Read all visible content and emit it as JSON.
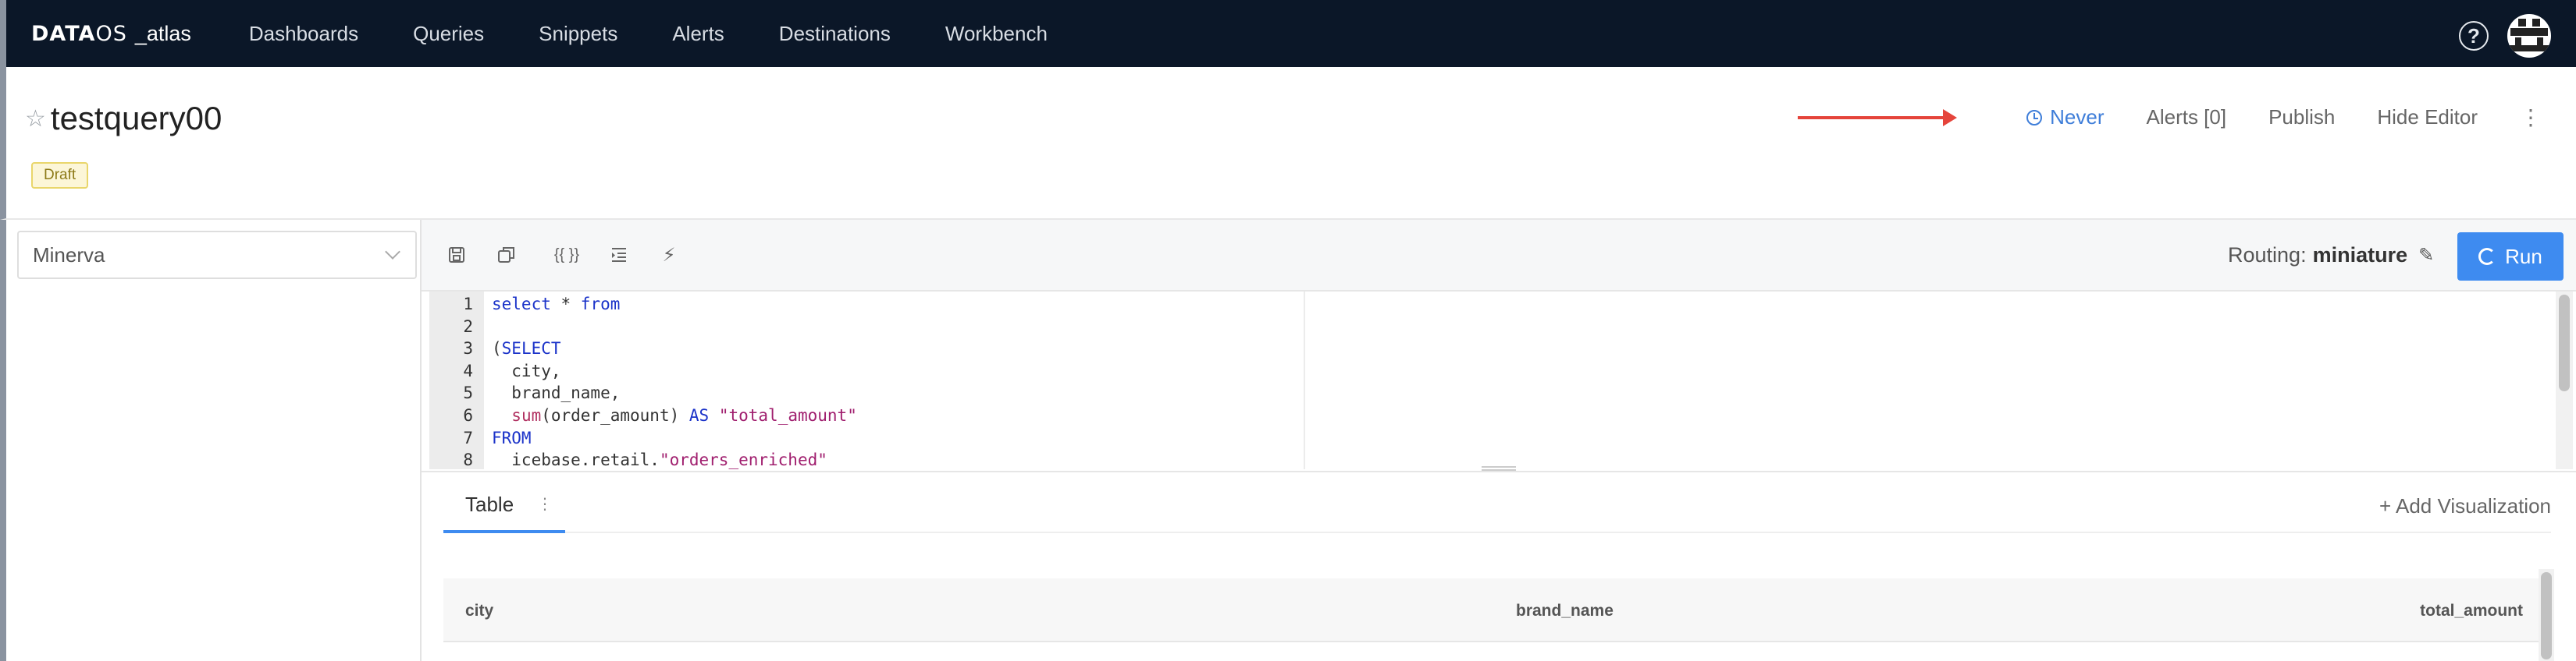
{
  "nav": {
    "logo_brand": "DATA",
    "logo_brand_thin": "OS",
    "logo_sub": "_atlas",
    "items": [
      {
        "label": "Dashboards"
      },
      {
        "label": "Queries"
      },
      {
        "label": "Snippets"
      },
      {
        "label": "Alerts"
      },
      {
        "label": "Destinations"
      },
      {
        "label": "Workbench"
      }
    ],
    "help_glyph": "?"
  },
  "header": {
    "star_glyph": "☆",
    "title": "testquery00",
    "badge": "Draft",
    "refresh_label": "Never",
    "alerts_label": "Alerts [0]",
    "publish_label": "Publish",
    "hide_editor_label": "Hide Editor",
    "kebab_glyph": "⋮",
    "arrow_color": "#e5443b"
  },
  "sidebar": {
    "data_source": "Minerva"
  },
  "toolbar": {
    "icons": [
      "save-icon",
      "duplicate-icon",
      "format-braces-icon",
      "indent-icon",
      "autocomplete-lightning-icon"
    ],
    "braces_glyph": "{{ }}",
    "lightning_glyph": "⚡",
    "routing_label": "Routing:",
    "routing_value": "miniature",
    "pencil_glyph": "✎",
    "run_label": "Run",
    "run_color": "#3e8bf0"
  },
  "editor": {
    "lines": [
      {
        "n": "1",
        "text": "select * from"
      },
      {
        "n": "2",
        "text": ""
      },
      {
        "n": "3",
        "text": "(SELECT"
      },
      {
        "n": "4",
        "text": "  city,"
      },
      {
        "n": "5",
        "text": "  brand_name,"
      },
      {
        "n": "6",
        "text": "  sum(order_amount) AS \"total_amount\""
      },
      {
        "n": "7",
        "text": "FROM"
      },
      {
        "n": "8",
        "text": "  icebase.retail.\"orders_enriched\""
      }
    ]
  },
  "results": {
    "tab_label": "Table",
    "tab_kebab": "⋮",
    "add_visualization": "+ Add Visualization",
    "columns": [
      "city",
      "brand_name",
      "total_amount"
    ]
  }
}
